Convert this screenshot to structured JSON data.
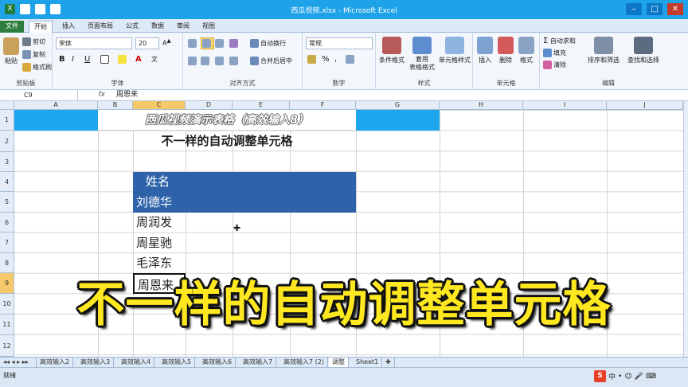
{
  "window": {
    "title": "西瓜视频.xlsx - Microsoft Excel"
  },
  "ribbon_tabs": [
    "文件",
    "开始",
    "插入",
    "页面布局",
    "公式",
    "数据",
    "审阅",
    "视图"
  ],
  "clipboard": {
    "paste": "粘贴",
    "cut": "剪切",
    "copy": "复制",
    "painter": "格式刷",
    "label": "剪贴板"
  },
  "font": {
    "name": "宋体",
    "size": "20",
    "label": "字体",
    "bold": "B",
    "italic": "I",
    "underline": "U",
    "phonetic": "文"
  },
  "alignment": {
    "wrap": "自动换行",
    "merge": "合并后居中",
    "label": "对齐方式"
  },
  "number": {
    "format": "常规",
    "label": "数字"
  },
  "styles": {
    "cond": "条件格式",
    "table": "套用\n表格格式",
    "cell": "单元格样式",
    "label": "样式"
  },
  "cells": {
    "insert": "插入",
    "delete": "删除",
    "format": "格式",
    "label": "单元格"
  },
  "editing": {
    "autosum": "自动求和",
    "fill": "填充",
    "clear": "清除",
    "sort": "排序和筛选",
    "find": "查找和选择",
    "label": "编辑"
  },
  "formula_bar": {
    "name_box": "C9",
    "fx": "fx",
    "value": "周恩来"
  },
  "columns": [
    "A",
    "B",
    "C",
    "D",
    "E",
    "F",
    "G",
    "H",
    "I",
    "J"
  ],
  "rows": [
    "1",
    "2",
    "3",
    "4",
    "5",
    "6",
    "7",
    "8",
    "9",
    "10",
    "11",
    "12"
  ],
  "sheet": {
    "title_banner": "西瓜视频演示表格（高效输入8）",
    "heading": "不一样的自动调整单元格",
    "header_name": "姓名",
    "names": [
      "刘德华",
      "周润发",
      "周星驰",
      "毛泽东",
      "周恩来"
    ]
  },
  "sheet_tabs": [
    "高效输入2",
    "高效输入3",
    "高效输入4",
    "高效输入5",
    "高效输入6",
    "高效输入7",
    "高效输入7 (2)",
    "调整",
    "Sheet1"
  ],
  "status": {
    "ready": "就绪",
    "ime_brand": "S",
    "ime_lang": "中"
  },
  "overlay_caption": "不一样的自动调整单元格",
  "colors": {
    "accent": "#1fa3e8",
    "header_fill": "#2e63aa",
    "selection": "#f5c96a",
    "caption": "#ffe81f"
  }
}
